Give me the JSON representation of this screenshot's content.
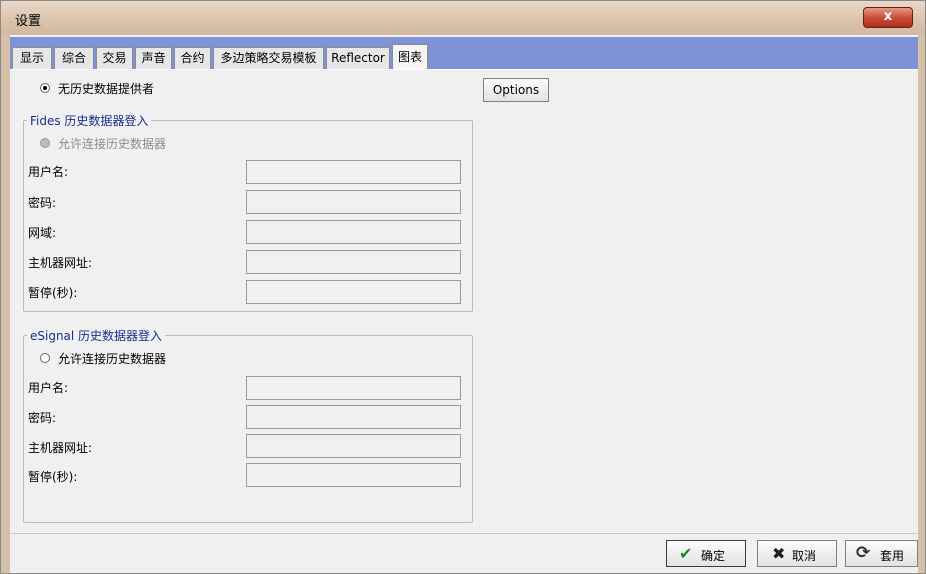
{
  "window": {
    "title": "设置",
    "close_label": "x"
  },
  "tabs": [
    {
      "label": "显示"
    },
    {
      "label": "综合"
    },
    {
      "label": "交易"
    },
    {
      "label": "声音"
    },
    {
      "label": "合约"
    },
    {
      "label": "多边策略交易模板"
    },
    {
      "label": "Reflector"
    },
    {
      "label": "图表"
    }
  ],
  "active_tab": "图表",
  "no_provider": {
    "label": "无历史数据提供者",
    "selected": true
  },
  "options_button": "Options",
  "fides": {
    "title": "Fides 历史数据器登入",
    "allow_label": "允许连接历史数据器",
    "fields": {
      "username": "用户名:",
      "password": "密码:",
      "domain": "网域:",
      "host": "主机器网址:",
      "timeout": "暂停(秒):"
    }
  },
  "esignal": {
    "title": "eSignal 历史数据器登入",
    "allow_label": "允许连接历史数据器",
    "fields": {
      "username": "用户名:",
      "password": "密码:",
      "host": "主机器网址:",
      "timeout": "暂停(秒):"
    }
  },
  "footer": {
    "ok": "确定",
    "cancel": "取消",
    "apply": "套用"
  },
  "colors": {
    "tab_strip": "#7f92d6",
    "titlebar": "#d9c2ab",
    "close": "#c94f38"
  }
}
